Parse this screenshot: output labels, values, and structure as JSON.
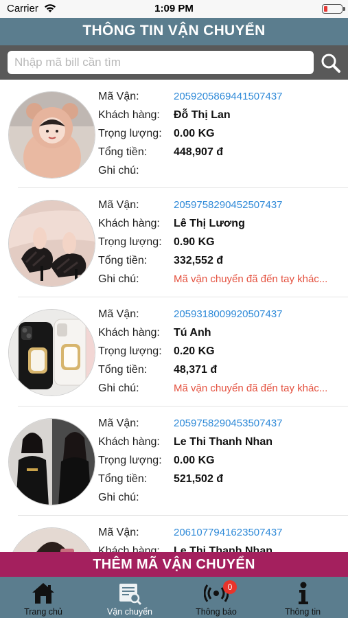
{
  "status_bar": {
    "carrier": "Carrier",
    "time": "1:09 PM"
  },
  "header": {
    "title": "THÔNG TIN VẬN CHUYỂN"
  },
  "search": {
    "placeholder": "Nhập mã bill cần tìm",
    "value": ""
  },
  "labels": {
    "code": "Mã Vận:",
    "customer": "Khách hàng:",
    "weight": "Trọng lượng:",
    "total": "Tổng tiền:",
    "note": "Ghi chú:"
  },
  "items": [
    {
      "code": "2059205869441507437",
      "customer": "Đỗ Thị Lan",
      "weight": "0.00 KG",
      "total": "448,907 đ",
      "note": "",
      "photo": "girl-in-bear-hood"
    },
    {
      "code": "2059758290452507437",
      "customer": "Lê Thị Lương",
      "weight": "0.90 KG",
      "total": "332,552 đ",
      "note": "Mã vận chuyển đã đến tay khác...",
      "photo": "black-heeled-sandals"
    },
    {
      "code": "2059318009920507437",
      "customer": "Tú Anh",
      "weight": "0.20 KG",
      "total": "48,371 đ",
      "note": "Mã vận chuyển đã đến tay khác...",
      "photo": "phone-cases-with-mirror"
    },
    {
      "code": "2059758290453507437",
      "customer": "Le Thi Thanh Nhan",
      "weight": "0.00 KG",
      "total": "521,502 đ",
      "note": "",
      "photo": "women-in-black-outfits"
    },
    {
      "code": "2061077941623507437",
      "customer": "Le Thi Thanh Nhan",
      "weight": "",
      "total": "",
      "note": "",
      "photo": "woman-selfie"
    }
  ],
  "add_button": {
    "label": "THÊM MÃ VẬN CHUYỂN"
  },
  "tabs": [
    {
      "label": "Trang chủ",
      "icon": "home-icon",
      "active": false
    },
    {
      "label": "Vận chuyển",
      "icon": "shipping-search-icon",
      "active": true
    },
    {
      "label": "Thông báo",
      "icon": "broadcast-icon",
      "active": false,
      "badge": "0"
    },
    {
      "label": "Thông tin",
      "icon": "info-icon",
      "active": false
    }
  ],
  "colors": {
    "header": "#5b7d8e",
    "search_bar": "#595959",
    "code_text": "#2f8ad8",
    "note_text": "#e4513f",
    "add_button": "#a4205e",
    "badge": "#e8342b"
  }
}
